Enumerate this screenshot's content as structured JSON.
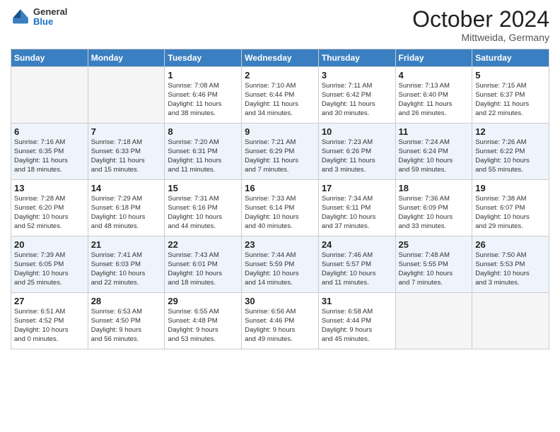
{
  "logo": {
    "general": "General",
    "blue": "Blue"
  },
  "header": {
    "month": "October 2024",
    "location": "Mittweida, Germany"
  },
  "weekdays": [
    "Sunday",
    "Monday",
    "Tuesday",
    "Wednesday",
    "Thursday",
    "Friday",
    "Saturday"
  ],
  "weeks": [
    [
      {
        "day": "",
        "info": ""
      },
      {
        "day": "",
        "info": ""
      },
      {
        "day": "1",
        "info": "Sunrise: 7:08 AM\nSunset: 6:46 PM\nDaylight: 11 hours\nand 38 minutes."
      },
      {
        "day": "2",
        "info": "Sunrise: 7:10 AM\nSunset: 6:44 PM\nDaylight: 11 hours\nand 34 minutes."
      },
      {
        "day": "3",
        "info": "Sunrise: 7:11 AM\nSunset: 6:42 PM\nDaylight: 11 hours\nand 30 minutes."
      },
      {
        "day": "4",
        "info": "Sunrise: 7:13 AM\nSunset: 6:40 PM\nDaylight: 11 hours\nand 26 minutes."
      },
      {
        "day": "5",
        "info": "Sunrise: 7:15 AM\nSunset: 6:37 PM\nDaylight: 11 hours\nand 22 minutes."
      }
    ],
    [
      {
        "day": "6",
        "info": "Sunrise: 7:16 AM\nSunset: 6:35 PM\nDaylight: 11 hours\nand 18 minutes."
      },
      {
        "day": "7",
        "info": "Sunrise: 7:18 AM\nSunset: 6:33 PM\nDaylight: 11 hours\nand 15 minutes."
      },
      {
        "day": "8",
        "info": "Sunrise: 7:20 AM\nSunset: 6:31 PM\nDaylight: 11 hours\nand 11 minutes."
      },
      {
        "day": "9",
        "info": "Sunrise: 7:21 AM\nSunset: 6:29 PM\nDaylight: 11 hours\nand 7 minutes."
      },
      {
        "day": "10",
        "info": "Sunrise: 7:23 AM\nSunset: 6:26 PM\nDaylight: 11 hours\nand 3 minutes."
      },
      {
        "day": "11",
        "info": "Sunrise: 7:24 AM\nSunset: 6:24 PM\nDaylight: 10 hours\nand 59 minutes."
      },
      {
        "day": "12",
        "info": "Sunrise: 7:26 AM\nSunset: 6:22 PM\nDaylight: 10 hours\nand 55 minutes."
      }
    ],
    [
      {
        "day": "13",
        "info": "Sunrise: 7:28 AM\nSunset: 6:20 PM\nDaylight: 10 hours\nand 52 minutes."
      },
      {
        "day": "14",
        "info": "Sunrise: 7:29 AM\nSunset: 6:18 PM\nDaylight: 10 hours\nand 48 minutes."
      },
      {
        "day": "15",
        "info": "Sunrise: 7:31 AM\nSunset: 6:16 PM\nDaylight: 10 hours\nand 44 minutes."
      },
      {
        "day": "16",
        "info": "Sunrise: 7:33 AM\nSunset: 6:14 PM\nDaylight: 10 hours\nand 40 minutes."
      },
      {
        "day": "17",
        "info": "Sunrise: 7:34 AM\nSunset: 6:11 PM\nDaylight: 10 hours\nand 37 minutes."
      },
      {
        "day": "18",
        "info": "Sunrise: 7:36 AM\nSunset: 6:09 PM\nDaylight: 10 hours\nand 33 minutes."
      },
      {
        "day": "19",
        "info": "Sunrise: 7:38 AM\nSunset: 6:07 PM\nDaylight: 10 hours\nand 29 minutes."
      }
    ],
    [
      {
        "day": "20",
        "info": "Sunrise: 7:39 AM\nSunset: 6:05 PM\nDaylight: 10 hours\nand 25 minutes."
      },
      {
        "day": "21",
        "info": "Sunrise: 7:41 AM\nSunset: 6:03 PM\nDaylight: 10 hours\nand 22 minutes."
      },
      {
        "day": "22",
        "info": "Sunrise: 7:43 AM\nSunset: 6:01 PM\nDaylight: 10 hours\nand 18 minutes."
      },
      {
        "day": "23",
        "info": "Sunrise: 7:44 AM\nSunset: 5:59 PM\nDaylight: 10 hours\nand 14 minutes."
      },
      {
        "day": "24",
        "info": "Sunrise: 7:46 AM\nSunset: 5:57 PM\nDaylight: 10 hours\nand 11 minutes."
      },
      {
        "day": "25",
        "info": "Sunrise: 7:48 AM\nSunset: 5:55 PM\nDaylight: 10 hours\nand 7 minutes."
      },
      {
        "day": "26",
        "info": "Sunrise: 7:50 AM\nSunset: 5:53 PM\nDaylight: 10 hours\nand 3 minutes."
      }
    ],
    [
      {
        "day": "27",
        "info": "Sunrise: 6:51 AM\nSunset: 4:52 PM\nDaylight: 10 hours\nand 0 minutes."
      },
      {
        "day": "28",
        "info": "Sunrise: 6:53 AM\nSunset: 4:50 PM\nDaylight: 9 hours\nand 56 minutes."
      },
      {
        "day": "29",
        "info": "Sunrise: 6:55 AM\nSunset: 4:48 PM\nDaylight: 9 hours\nand 53 minutes."
      },
      {
        "day": "30",
        "info": "Sunrise: 6:56 AM\nSunset: 4:46 PM\nDaylight: 9 hours\nand 49 minutes."
      },
      {
        "day": "31",
        "info": "Sunrise: 6:58 AM\nSunset: 4:44 PM\nDaylight: 9 hours\nand 45 minutes."
      },
      {
        "day": "",
        "info": ""
      },
      {
        "day": "",
        "info": ""
      }
    ]
  ]
}
